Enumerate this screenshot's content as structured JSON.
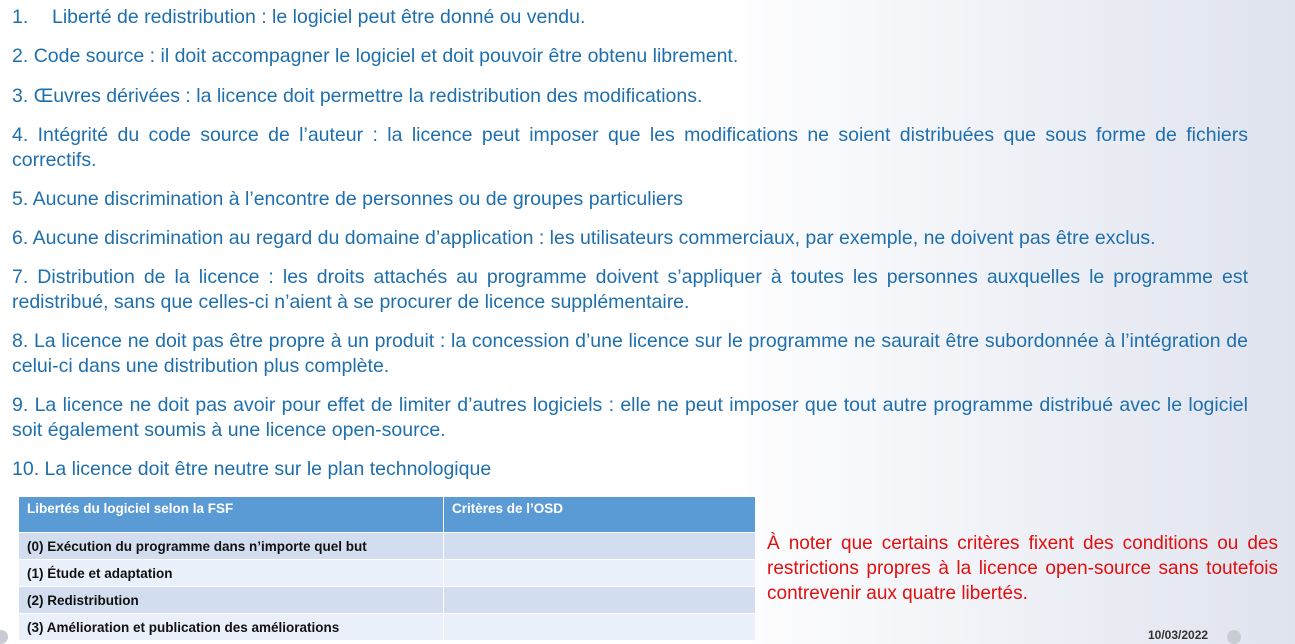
{
  "criteria": [
    {
      "num": "1.",
      "text": "Liberté de redistribution : le logiciel peut être donné ou vendu."
    },
    {
      "num": "2.",
      "text": "Code source : il doit accompagner le logiciel et doit pouvoir être obtenu librement."
    },
    {
      "num": "3.",
      "text": "Œuvres dérivées : la licence doit permettre la redistribution des modifications."
    },
    {
      "num": "4.",
      "text": "Intégrité du code source de l’auteur : la licence peut imposer que les modifications ne soient distribuées que sous forme de fichiers correctifs."
    },
    {
      "num": "5.",
      "text": "Aucune discrimination à l’encontre de personnes ou de groupes particuliers"
    },
    {
      "num": "6.",
      "text": "Aucune discrimination au regard du domaine d’application : les utilisateurs commerciaux, par exemple, ne doivent pas être exclus."
    },
    {
      "num": "7.",
      "text": "Distribution de la licence : les droits attachés au programme doivent s’appliquer à toutes les personnes auxquelles le programme est redistribué, sans que celles-ci n’aient à se procurer de licence supplémentaire."
    },
    {
      "num": "8.",
      "text": "La licence ne doit pas être propre à un produit : la concession d’une licence sur le programme ne saurait être subordonnée à l’intégration de celui-ci dans une distribution plus complète."
    },
    {
      "num": "9.",
      "text": "La licence ne doit pas avoir pour effet de limiter d’autres logiciels : elle ne peut imposer que tout autre programme distribué avec le logiciel soit également soumis à une licence open-source."
    },
    {
      "num": "10.",
      "text": "La licence doit être neutre sur le plan technologique"
    }
  ],
  "table": {
    "headers": [
      "Libertés du logiciel selon la FSF",
      "Critères de l’OSD"
    ],
    "rows": [
      [
        "(0) Exécution du programme dans n’importe quel but",
        ""
      ],
      [
        "(1) Étude et adaptation",
        ""
      ],
      [
        "(2) Redistribution",
        ""
      ],
      [
        "(3) Amélioration et publication des améliorations",
        ""
      ]
    ]
  },
  "note": "À noter que certains critères fixent des conditions ou des restrictions propres à la licence open-source sans toutefois contrevenir aux quatre libertés.",
  "footer_date": "10/03/2022",
  "colors": {
    "text_blue": "#1f6fad",
    "note_red": "#e01010",
    "header_blue": "#5b9bd5"
  }
}
